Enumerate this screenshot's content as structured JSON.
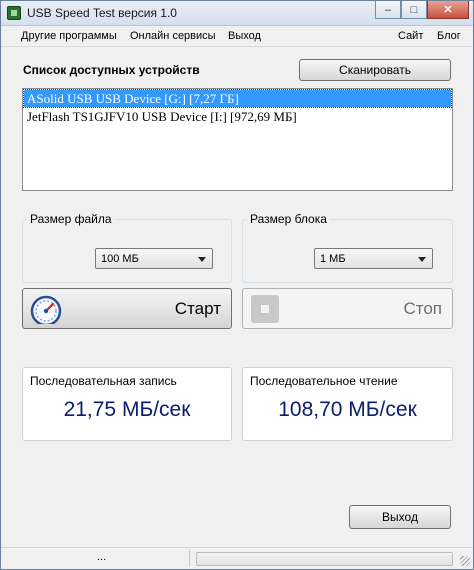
{
  "window": {
    "title": "USB Speed Test версия 1.0"
  },
  "menu": {
    "left": [
      "Другие программы",
      "Онлайн сервисы",
      "Выход"
    ],
    "right": [
      "Сайт",
      "Блог"
    ]
  },
  "devices": {
    "title": "Список доступных устройств",
    "scan_label": "Сканировать",
    "items": [
      "ASolid USB USB Device  [G:] [7,27 ГБ]",
      "JetFlash TS1GJFV10 USB Device  [I:] [972,69 МБ]"
    ],
    "selected_index": 0
  },
  "file_size": {
    "label": "Размер файла",
    "value": "100 МБ"
  },
  "block_size": {
    "label": "Размер блока",
    "value": "1 МБ"
  },
  "start_label": "Старт",
  "stop_label": "Стоп",
  "write": {
    "label": "Последовательная запись",
    "value": "21,75 МБ/сек"
  },
  "read": {
    "label": "Последовательное чтение",
    "value": "108,70 МБ/сек"
  },
  "exit_label": "Выход",
  "status": {
    "text": "...",
    "progress": 0
  },
  "colors": {
    "selection": "#3399ff",
    "result_text": "#0b1e6e"
  }
}
